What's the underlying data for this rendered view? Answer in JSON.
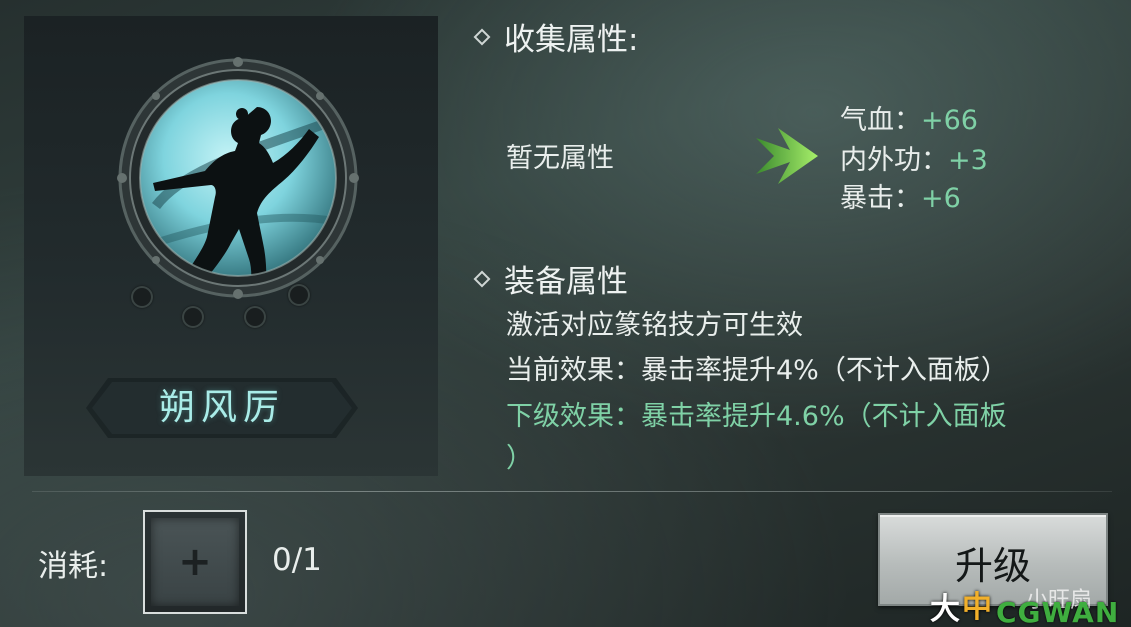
{
  "collection_section": {
    "heading": "收集属性:",
    "current_text": "暂无属性",
    "stats": [
      {
        "label": "气血：",
        "value": "+66"
      },
      {
        "label": "内外功：",
        "value": "+3"
      },
      {
        "label": "暴击：",
        "value": "+6"
      }
    ]
  },
  "equipment_section": {
    "heading": "装备属性",
    "activation_hint": "激活对应篆铭技方可生效",
    "current_effect": "当前效果：暴击率提升4%（不计入面板）",
    "next_effect_line1": "下级效果：暴击率提升4.6%（不计入面板",
    "next_effect_line2": "）"
  },
  "skill": {
    "name": "朔风厉",
    "slot_dots_filled": 0,
    "slot_dots_total": 4
  },
  "bottom_bar": {
    "consume_label": "消耗:",
    "slot_symbol": "+",
    "count": "0/1",
    "upgrade_label": "升级"
  },
  "watermark": {
    "da": "大",
    "zhong": "中",
    "small_text": "小旺扇",
    "brand": "CGWAN"
  },
  "colors": {
    "accent_green": "#7fd1a6",
    "name_cyan": "#a9ece8",
    "emblem_cyan": "#8fdde6"
  }
}
